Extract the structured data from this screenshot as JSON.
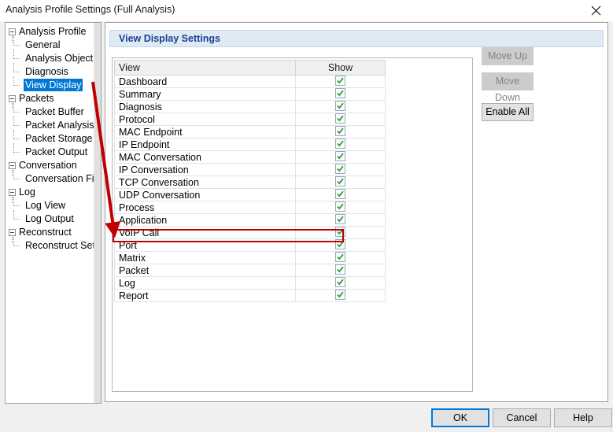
{
  "window": {
    "title": "Analysis Profile Settings (Full Analysis)",
    "close_icon": "close-icon"
  },
  "sidebar": {
    "nodes": [
      {
        "label": "Analysis Profile",
        "level": 0,
        "expanded": true,
        "selected": false
      },
      {
        "label": "General",
        "level": 1,
        "expanded": false,
        "selected": false
      },
      {
        "label": "Analysis Object",
        "level": 1,
        "expanded": false,
        "selected": false
      },
      {
        "label": "Diagnosis",
        "level": 1,
        "expanded": false,
        "selected": false
      },
      {
        "label": "View Display",
        "level": 1,
        "expanded": false,
        "selected": true
      },
      {
        "label": "Packets",
        "level": 0,
        "expanded": true,
        "selected": false
      },
      {
        "label": "Packet Buffer",
        "level": 1,
        "expanded": false,
        "selected": false
      },
      {
        "label": "Packet Analysis",
        "level": 1,
        "expanded": false,
        "selected": false
      },
      {
        "label": "Packet Storage",
        "level": 1,
        "expanded": false,
        "selected": false
      },
      {
        "label": "Packet Output",
        "level": 1,
        "expanded": false,
        "selected": false
      },
      {
        "label": "Conversation",
        "level": 0,
        "expanded": true,
        "selected": false
      },
      {
        "label": "Conversation Filter",
        "level": 1,
        "expanded": false,
        "selected": false
      },
      {
        "label": "Log",
        "level": 0,
        "expanded": true,
        "selected": false
      },
      {
        "label": "Log View",
        "level": 1,
        "expanded": false,
        "selected": false
      },
      {
        "label": "Log Output",
        "level": 1,
        "expanded": false,
        "selected": false
      },
      {
        "label": "Reconstruct",
        "level": 0,
        "expanded": true,
        "selected": false
      },
      {
        "label": "Reconstruct Settings",
        "level": 1,
        "expanded": false,
        "selected": false
      }
    ]
  },
  "main": {
    "banner_title": "View Display Settings",
    "table": {
      "columns": [
        "View",
        "Show"
      ],
      "rows": [
        {
          "view": "Dashboard",
          "show": true,
          "highlighted": false
        },
        {
          "view": "Summary",
          "show": true,
          "highlighted": false
        },
        {
          "view": "Diagnosis",
          "show": true,
          "highlighted": false
        },
        {
          "view": "Protocol",
          "show": true,
          "highlighted": false
        },
        {
          "view": "MAC Endpoint",
          "show": true,
          "highlighted": false
        },
        {
          "view": "IP Endpoint",
          "show": true,
          "highlighted": false
        },
        {
          "view": "MAC Conversation",
          "show": true,
          "highlighted": false
        },
        {
          "view": "IP Conversation",
          "show": true,
          "highlighted": false
        },
        {
          "view": "TCP Conversation",
          "show": true,
          "highlighted": false
        },
        {
          "view": "UDP Conversation",
          "show": true,
          "highlighted": false
        },
        {
          "view": "Process",
          "show": true,
          "highlighted": false
        },
        {
          "view": "Application",
          "show": true,
          "highlighted": false
        },
        {
          "view": "VoIP Call",
          "show": true,
          "highlighted": true
        },
        {
          "view": "Port",
          "show": true,
          "highlighted": false
        },
        {
          "view": "Matrix",
          "show": true,
          "highlighted": false
        },
        {
          "view": "Packet",
          "show": true,
          "highlighted": false
        },
        {
          "view": "Log",
          "show": true,
          "highlighted": false
        },
        {
          "view": "Report",
          "show": true,
          "highlighted": false
        }
      ]
    },
    "side_buttons": [
      {
        "label": "Move Up",
        "enabled": false
      },
      {
        "label": "Move Down",
        "enabled": false
      },
      {
        "label": "Enable All",
        "enabled": true
      }
    ]
  },
  "footer": {
    "ok_label": "OK",
    "cancel_label": "Cancel",
    "help_label": "Help"
  },
  "annotations": {
    "arrow_color": "#c00000",
    "highlight_color": "#c00000"
  }
}
